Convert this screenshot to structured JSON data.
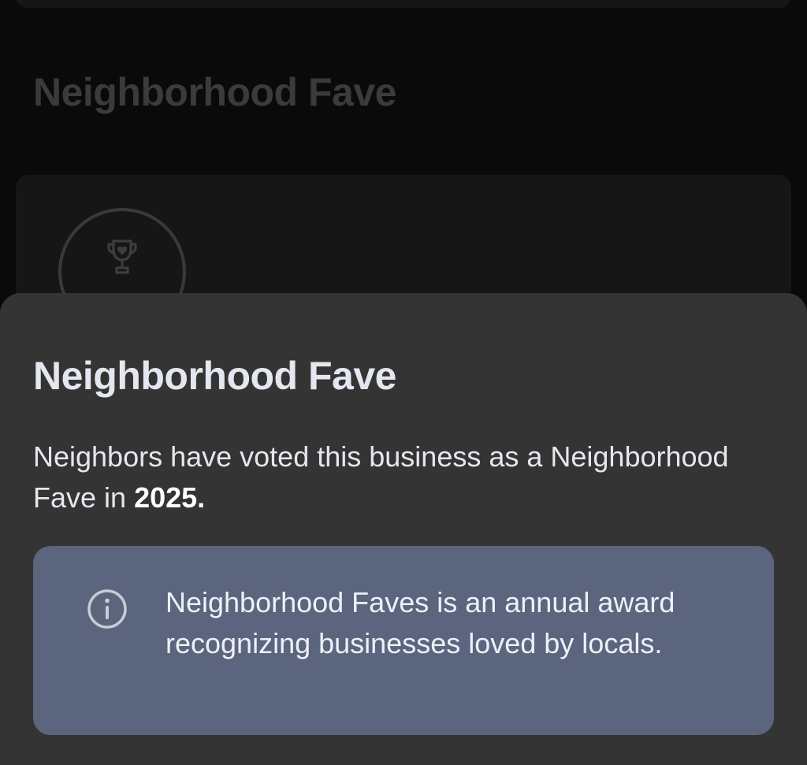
{
  "background": {
    "heading": "Neighborhood Fave",
    "badge_icon": "trophy-heart-icon"
  },
  "sheet": {
    "title": "Neighborhood Fave",
    "description_prefix": "Neighbors have voted this business as a Neighborhood Fave in ",
    "description_year": "2025.",
    "info": {
      "icon": "info-icon",
      "text": "Neighborhood Faves is an annual award recognizing businesses loved by locals."
    }
  },
  "colors": {
    "sheet_background": "#343434",
    "info_box_background": "#5b657e",
    "title_text": "#e4e6f0",
    "dimmed_heading": "#3b3b3e"
  }
}
